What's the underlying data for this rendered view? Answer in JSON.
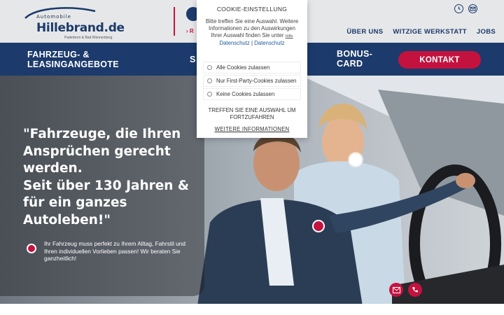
{
  "header": {
    "logo_small": "Automobile",
    "logo_brand": "Hillebrand.de",
    "logo_sub": "Paderborn & Bad Wünnenberg",
    "second_logo_text": "› R",
    "icons": [
      "clock-icon",
      "mail-icon"
    ],
    "nav": [
      "ÜBER UNS",
      "WITZIGE WERKSTATT",
      "JOBS"
    ]
  },
  "navbar": {
    "item1": "FAHRZEUG- & LEASINGANGEBOTE",
    "item2": "S",
    "item3": "BONUS-CARD",
    "cta": "KONTAKT"
  },
  "hero": {
    "headline": "\"Fahrzeuge, die Ihren\nAnsprüchen gerecht\nwerden.\nSeit über 130 Jahren &\nfür ein ganzes\nAutoleben!\"",
    "text": "Ihr Fahrzeug muss perfekt zu Ihrem Alltag, Fahrstil und Ihren individuellen Vorlieben passen! Wir beraten Sie ganzheitlich!",
    "buttons": [
      "mail-icon",
      "phone-icon"
    ]
  },
  "cookie": {
    "title": "COOKIE-EINSTELLUNG",
    "desc_before": "Bitte treffen Sie eine Auswahl. Weitere Informationen zu den Auswirkungen Ihrer Auswahl finden Sie unter ",
    "help_link": "Hilfe",
    "desc_link": "Datenschutz",
    "desc_sep": " | ",
    "desc_link2": "Datenschutz",
    "options": [
      "Alle Cookies zulassen",
      "Nur First-Party-Cookies zulassen",
      "Keine Cookies zulassen"
    ],
    "note": "TREFFEN SIE EINE AUSWAHL UM FORTZUFAHREN",
    "more": "WEITERE INFORMATIONEN"
  },
  "colors": {
    "navy": "#1c3a6b",
    "accent": "#c4123f",
    "header_bg": "#e6e7e9"
  }
}
